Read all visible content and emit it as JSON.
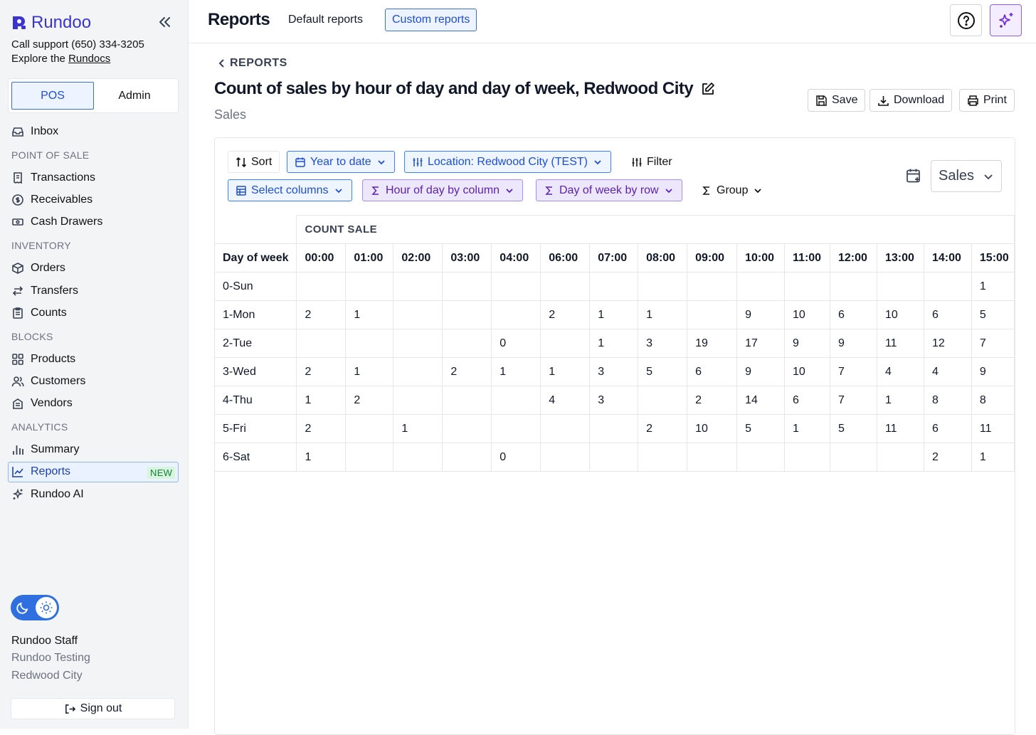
{
  "sidebar": {
    "brand": "Rundoo",
    "support_text": "Call support (650) 334-3205",
    "explore_prefix": "Explore the",
    "explore_link": "Rundocs",
    "mode_tabs": [
      "POS",
      "Admin"
    ],
    "inbox": "Inbox",
    "sections": {
      "pos": "POINT OF SALE",
      "inventory": "INVENTORY",
      "blocks": "BLOCKS",
      "analytics": "ANALYTICS"
    },
    "items": {
      "transactions": "Transactions",
      "receivables": "Receivables",
      "cash_drawers": "Cash Drawers",
      "orders": "Orders",
      "transfers": "Transfers",
      "counts": "Counts",
      "products": "Products",
      "customers": "Customers",
      "vendors": "Vendors",
      "summary": "Summary",
      "reports": "Reports",
      "reports_badge": "NEW",
      "rundoo_ai": "Rundoo AI"
    },
    "user": {
      "name": "Rundoo Staff",
      "org": "Rundoo Testing",
      "location": "Redwood City"
    },
    "sign_out": "Sign out"
  },
  "topbar": {
    "title": "Reports",
    "tabs": [
      "Default reports",
      "Custom reports"
    ],
    "active_tab": "Custom reports"
  },
  "report": {
    "back_label": "REPORTS",
    "title": "Count of sales by hour of day and day of week, Redwood City",
    "subtitle": "Sales",
    "actions": {
      "save": "Save",
      "download": "Download",
      "print": "Print"
    },
    "toolbar": {
      "sort": "Sort",
      "date_range": "Year to date",
      "location": "Location: Redwood City (TEST)",
      "filter": "Filter",
      "select_columns": "Select columns",
      "column_group": "Hour of day by column",
      "row_group": "Day of week by row",
      "group": "Group",
      "dataset": "Sales"
    },
    "table": {
      "group_header": "COUNT SALE",
      "row_header": "Day of week",
      "columns": [
        "00:00",
        "01:00",
        "02:00",
        "03:00",
        "04:00",
        "06:00",
        "07:00",
        "08:00",
        "09:00",
        "10:00",
        "11:00",
        "12:00",
        "13:00",
        "14:00",
        "15:00"
      ],
      "rows": [
        {
          "label": "0-Sun",
          "values": [
            "",
            "",
            "",
            "",
            "",
            "",
            "",
            "",
            "",
            "",
            "",
            "",
            "",
            "",
            "1"
          ]
        },
        {
          "label": "1-Mon",
          "values": [
            "2",
            "1",
            "",
            "",
            "",
            "2",
            "1",
            "1",
            "",
            "9",
            "10",
            "6",
            "10",
            "6",
            "5"
          ]
        },
        {
          "label": "2-Tue",
          "values": [
            "",
            "",
            "",
            "",
            "0",
            "",
            "1",
            "3",
            "19",
            "17",
            "9",
            "9",
            "11",
            "12",
            "7"
          ]
        },
        {
          "label": "3-Wed",
          "values": [
            "2",
            "1",
            "",
            "2",
            "1",
            "1",
            "3",
            "5",
            "6",
            "9",
            "10",
            "7",
            "4",
            "4",
            "9"
          ]
        },
        {
          "label": "4-Thu",
          "values": [
            "1",
            "2",
            "",
            "",
            "",
            "4",
            "3",
            "",
            "2",
            "14",
            "6",
            "7",
            "1",
            "8",
            "8"
          ]
        },
        {
          "label": "5-Fri",
          "values": [
            "2",
            "",
            "1",
            "",
            "",
            "",
            "",
            "2",
            "10",
            "5",
            "1",
            "5",
            "11",
            "6",
            "11"
          ]
        },
        {
          "label": "6-Sat",
          "values": [
            "1",
            "",
            "",
            "",
            "0",
            "",
            "",
            "",
            "",
            "",
            "",
            "",
            "",
            "2",
            "1"
          ]
        }
      ]
    }
  }
}
